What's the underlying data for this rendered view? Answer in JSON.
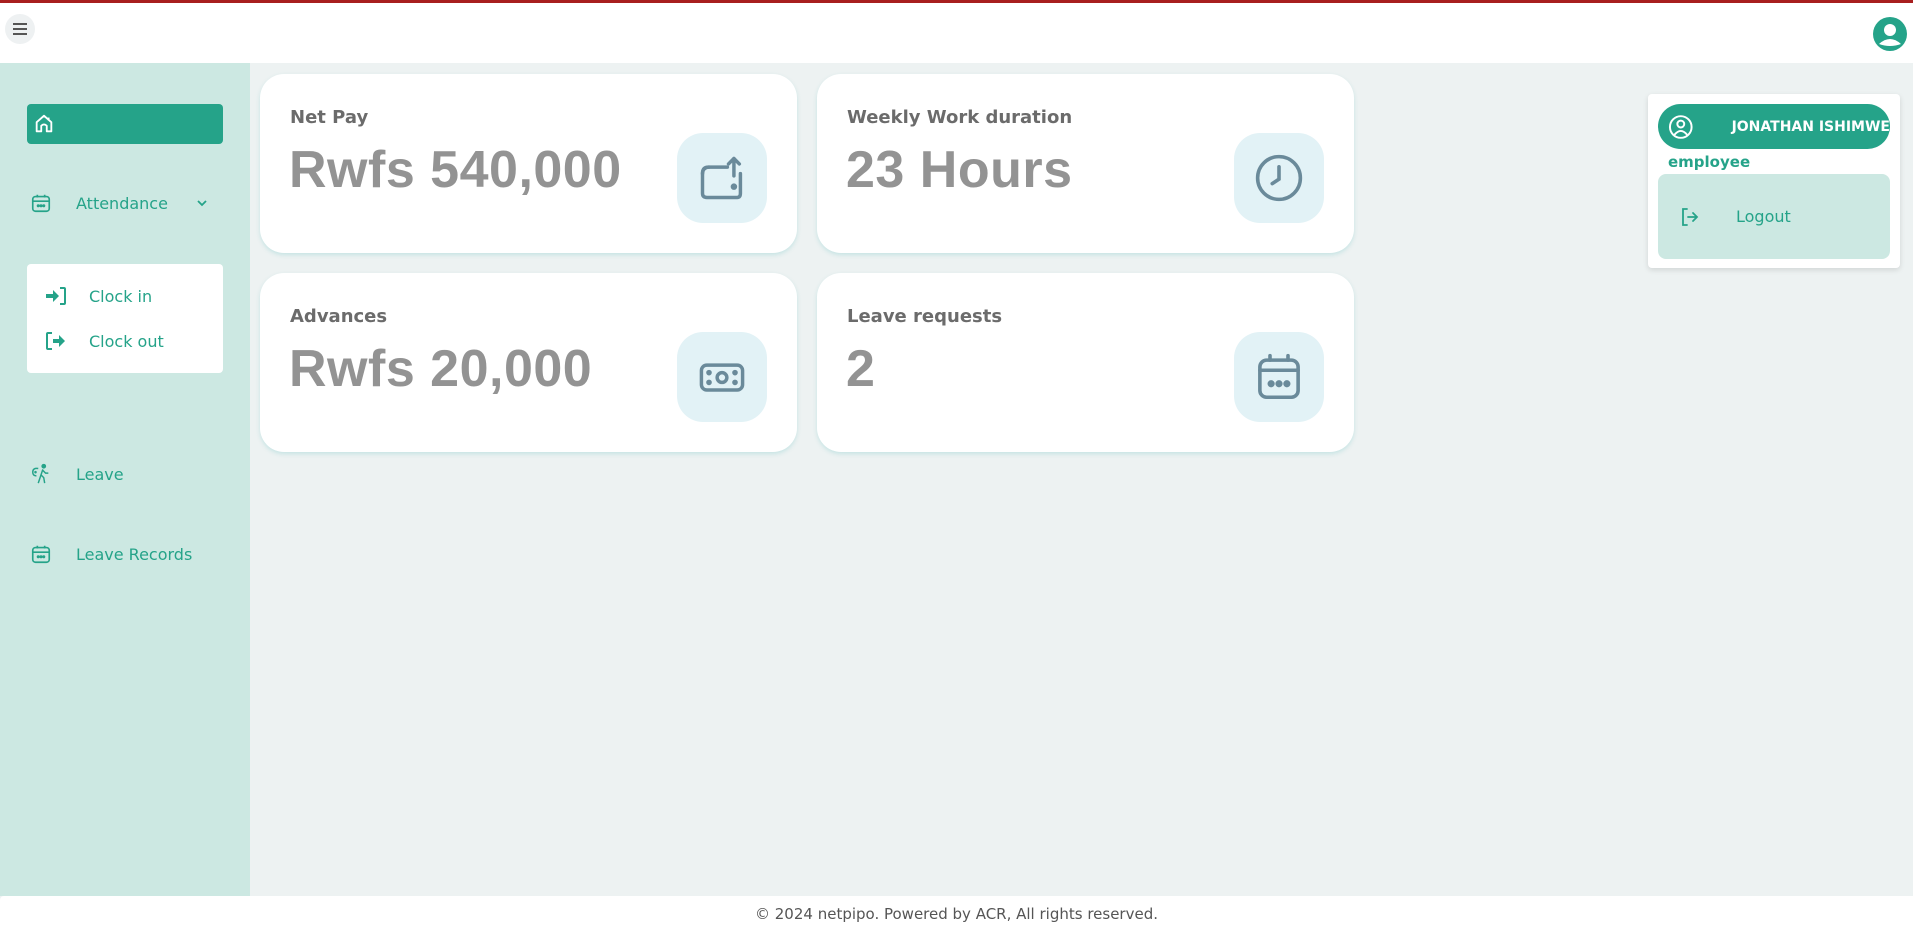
{
  "header": {
    "menu_icon": "hamburger-icon",
    "account_icon": "user-circle-icon",
    "accent_color": "#a81f1f"
  },
  "sidebar": {
    "home": {
      "icon": "home-icon"
    },
    "items": [
      {
        "label": "Attendance",
        "icon": "calendar-icon",
        "expanded": true,
        "children": [
          {
            "label": "Clock in",
            "icon": "sign-in-icon"
          },
          {
            "label": "Clock out",
            "icon": "sign-out-icon"
          }
        ]
      },
      {
        "label": "Leave",
        "icon": "walking-leave-icon"
      },
      {
        "label": "Leave Records",
        "icon": "calendar-icon"
      }
    ]
  },
  "cards": [
    {
      "title": "Net Pay",
      "value": "Rwfs 540,000",
      "icon": "wallet-upload-icon"
    },
    {
      "title": "Weekly Work duration",
      "value": "23 Hours",
      "icon": "clock-icon"
    },
    {
      "title": "Advances",
      "value": "Rwfs 20,000",
      "icon": "cash-icon"
    },
    {
      "title": "Leave requests",
      "value": "2",
      "icon": "calendar-icon"
    }
  ],
  "user_menu": {
    "name": "JONATHAN ISHIMWE",
    "role": "employee",
    "logout_label": "Logout"
  },
  "footer": {
    "text": "© 2024 netpipo. Powered by ACR, All rights reserved."
  },
  "colors": {
    "primary": "#25a389",
    "sidebar_bg": "#cce8e2",
    "page_bg": "#edf2f2",
    "icon_color": "#6a8a9a",
    "icon_bg": "#e2f2f6"
  }
}
